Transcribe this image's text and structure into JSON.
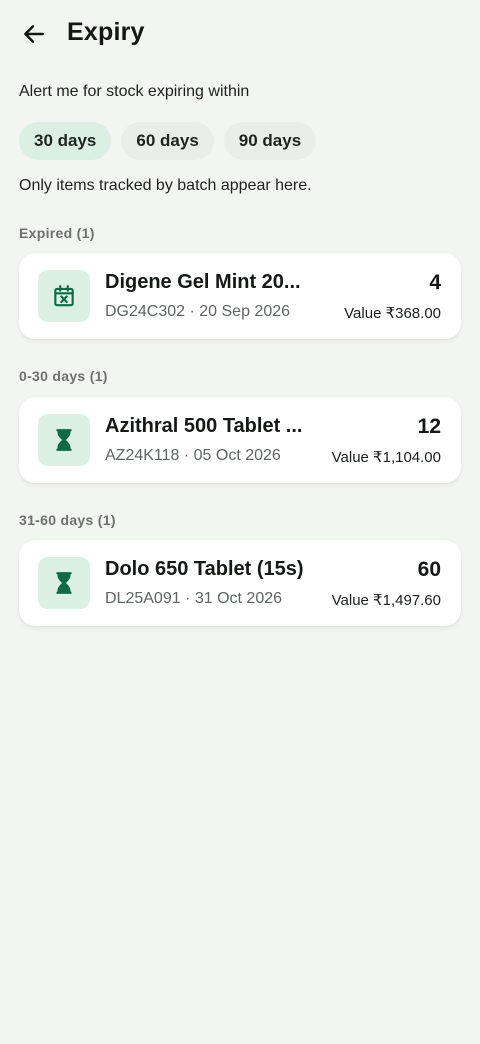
{
  "header": {
    "title": "Expiry",
    "back_icon": "arrow-left-icon"
  },
  "alert_label": "Alert me for stock expiring within",
  "chips": [
    {
      "label": "30 days",
      "selected": true
    },
    {
      "label": "60 days",
      "selected": false
    },
    {
      "label": "90 days",
      "selected": false
    }
  ],
  "note": "Only items tracked by batch appear here.",
  "colors": {
    "accent": "#0f6b45",
    "chip_selected": "#dcefe3",
    "background": "#f3f5f3"
  },
  "sections": [
    {
      "label": "Expired (1)",
      "item": {
        "icon": "calendar-x-icon",
        "name": "Digene Gel Mint 20...",
        "meta": "DG24C302 · 20 Sep 2026",
        "qty": "4",
        "value": "Value ₹368.00"
      }
    },
    {
      "label": "0-30 days (1)",
      "item": {
        "icon": "hourglass-icon",
        "name": "Azithral 500 Tablet ...",
        "meta": "AZ24K118 · 05 Oct 2026",
        "qty": "12",
        "value": "Value ₹1,104.00"
      }
    },
    {
      "label": "31-60 days (1)",
      "item": {
        "icon": "hourglass-icon",
        "name": "Dolo 650 Tablet (15s)",
        "meta": "DL25A091 · 31 Oct 2026",
        "qty": "60",
        "value": "Value ₹1,497.60"
      }
    }
  ]
}
